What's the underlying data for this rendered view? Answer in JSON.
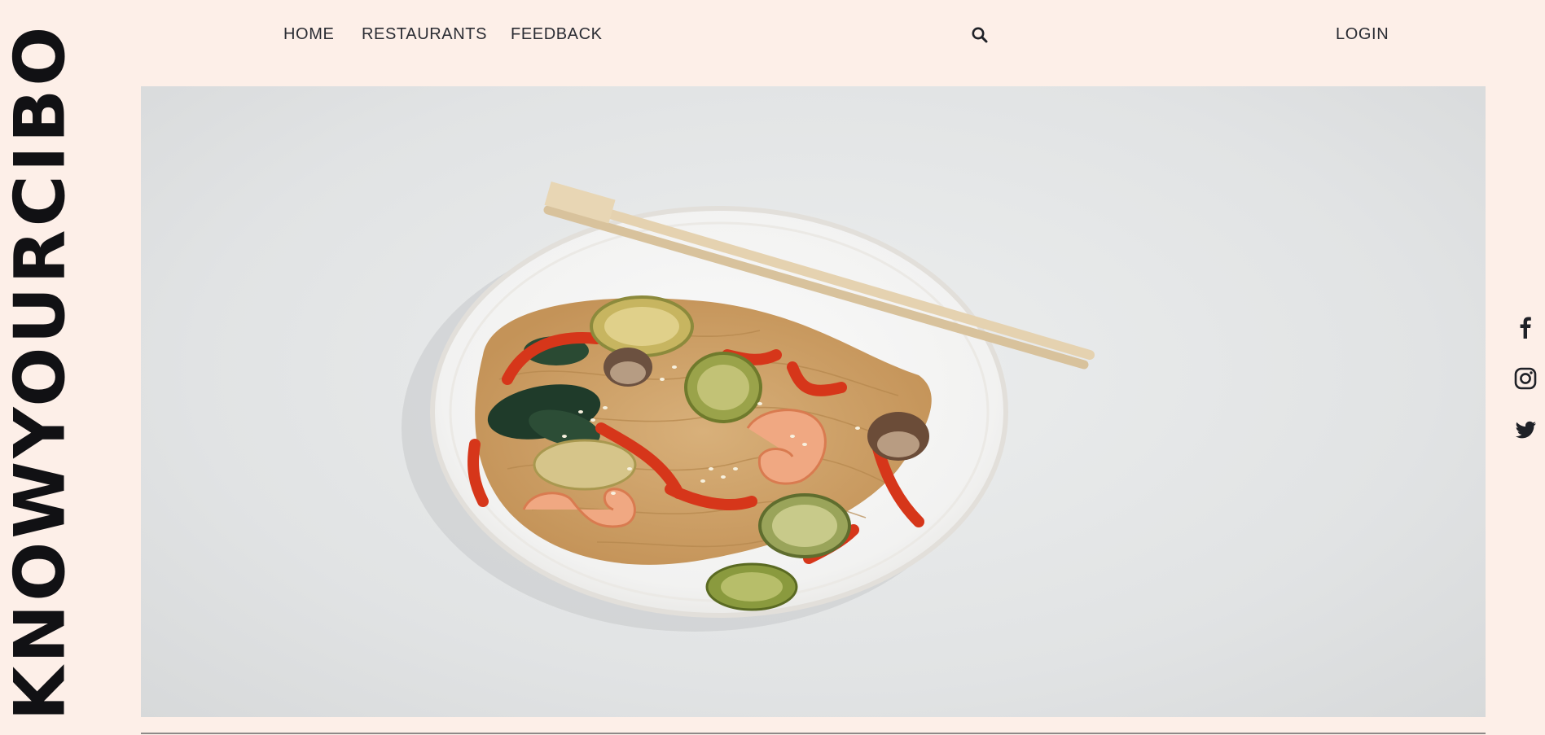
{
  "brand": {
    "logo_text": "KNOWYOURCIBO"
  },
  "nav": {
    "home": "HOME",
    "restaurants": "RESTAURANTS",
    "feedback": "FEEDBACK",
    "login": "LOGIN",
    "search_icon": "search-icon"
  },
  "social": {
    "icons": [
      "facebook-icon",
      "instagram-icon",
      "twitter-icon"
    ]
  },
  "colors": {
    "page_background": "#fdefe8",
    "text": "#2a2c33"
  }
}
